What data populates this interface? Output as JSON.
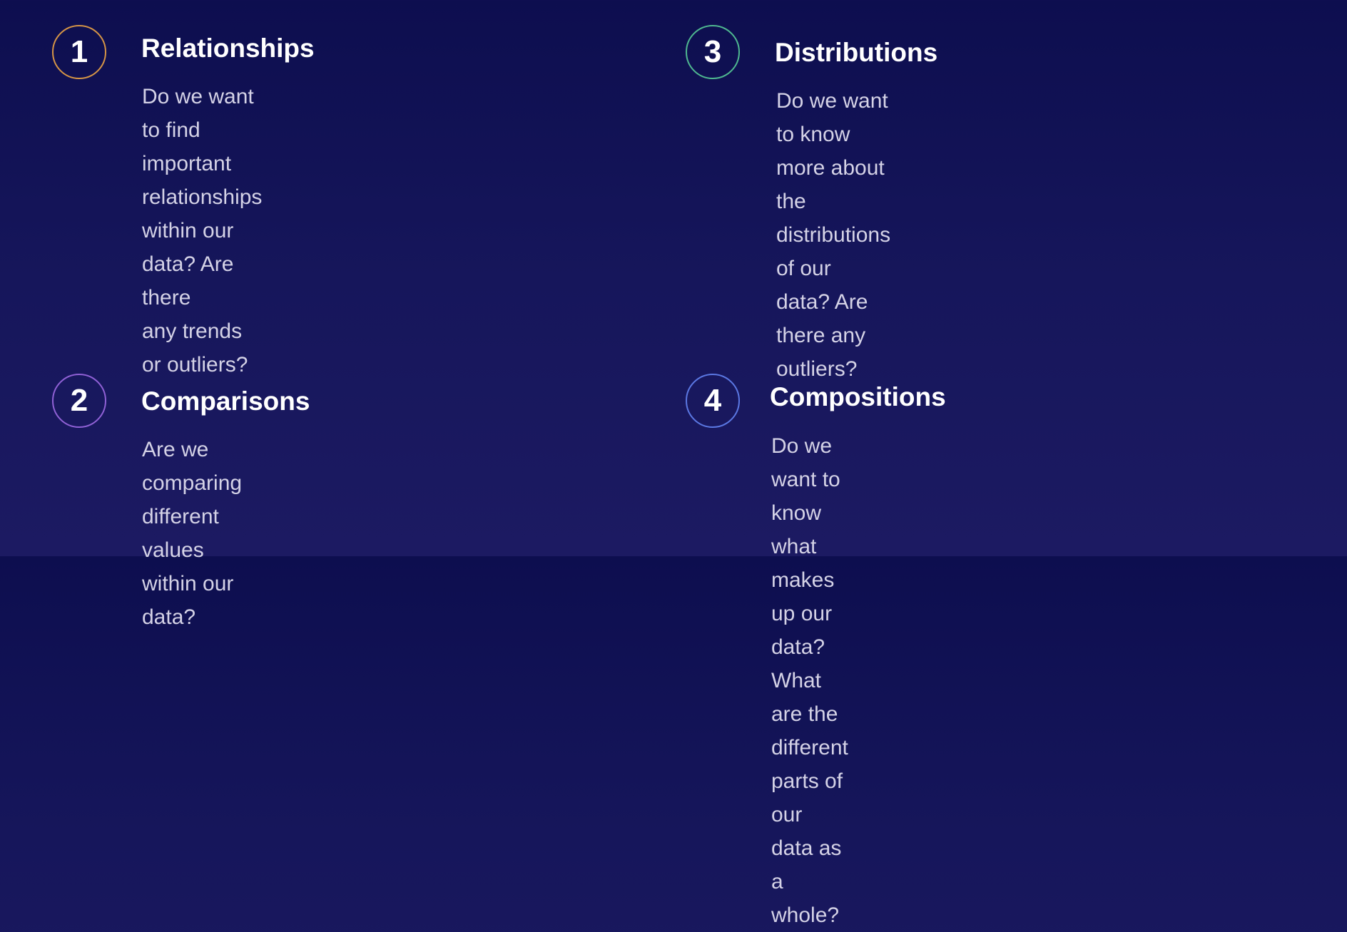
{
  "items": [
    {
      "number": "1",
      "title": "Relationships",
      "lines": [
        "Do we want to find important",
        "relationships within our data? Are there",
        "any trends or outliers?"
      ],
      "ring_color": "#d69546"
    },
    {
      "number": "2",
      "title": "Comparisons",
      "lines": [
        "Are we comparing different values",
        "within our data?"
      ],
      "ring_color": "#9061d6"
    },
    {
      "number": "3",
      "title": "Distributions",
      "lines": [
        "Do we want to know more about the",
        "distributions of our data? Are there any",
        "outliers?"
      ],
      "ring_color": "#4fb890"
    },
    {
      "number": "4",
      "title": "Compositions",
      "lines": [
        "Do we want to know what makes up our",
        "data? What are the different parts of our",
        "data as a whole?"
      ],
      "ring_color": "#5b78e3"
    }
  ]
}
